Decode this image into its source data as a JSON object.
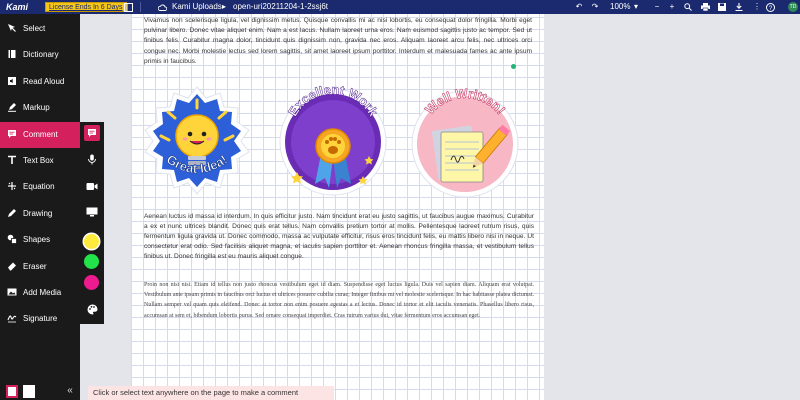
{
  "topbar": {
    "logo": "Kami",
    "license_badge": "License Ends In 6 Days",
    "breadcrumb_folder": "Kami Uploads",
    "breadcrumb_arrow": "▸",
    "document_name": "open-uri20211204-1-2ssj6t",
    "zoom": "100%",
    "user_initials": "TD"
  },
  "sidebar": {
    "tools": [
      {
        "label": "Select",
        "icon": "cursor-icon"
      },
      {
        "label": "Dictionary",
        "icon": "book-icon"
      },
      {
        "label": "Read Aloud",
        "icon": "speaker-icon"
      },
      {
        "label": "Markup",
        "icon": "highlighter-icon"
      },
      {
        "label": "Comment",
        "icon": "comment-icon",
        "active": true
      },
      {
        "label": "Text Box",
        "icon": "text-icon"
      },
      {
        "label": "Equation",
        "icon": "equation-icon"
      },
      {
        "label": "Drawing",
        "icon": "pen-icon"
      },
      {
        "label": "Shapes",
        "icon": "shapes-icon"
      },
      {
        "label": "Eraser",
        "icon": "eraser-icon"
      },
      {
        "label": "Add Media",
        "icon": "media-icon"
      },
      {
        "label": "Signature",
        "icon": "signature-icon"
      }
    ],
    "collapse_glyph": "«"
  },
  "comment_options": {
    "swatches": [
      "#ffeb3b",
      "#22e34a",
      "#ee1a8f"
    ],
    "selected_swatch": "#ffeb3b"
  },
  "document": {
    "paragraph_1": "Vivamus non scelerisque ligula, vel dignissim metus. Quisque convallis mi ac nisi lobortis, eu consequat dolor fringilla. Morbi eget pulvinar libero. Donec vitae aliquet enim. Nam a est lacus. Nullam laoreet urna eros. Nam euismod sagittis justo ac tempor. Sed ut finibus felis. Curabitur magna dolor, tincidunt quis dignissim non, gravida nec eros. Aliquam laoreet arcu felis, nec ultrices orci congue nec. Morbi molestie lectus sed lorem sagittis, sit amet laoreet ipsum porttitor. Interdum et malesuada fames ac ante ipsum primis in faucibus.",
    "paragraph_2": "Aenean luctus id massa id interdum. In quis efficitur justo. Nam tincidunt erat eu justo sagittis, ut faucibus augue maximus. Curabitur a ex et nunc ultrices blandit. Donec quis erat tellus. Nam convallis pretium tortor at mollis. Pellentesque laoreet rutrum risus, quis fermentum ligula gravida ut. Donec commodo, massa ac vulputate efficitur, risus eros tincidunt felis, eu mattis libero nisi in neque. Ut consectetur erat odio. Sed facilisis aliquet magna, et iaculis sapien porttitor et. Aenean rhoncus fringilla massa, et vestibulum tellus finibus ut. Donec fringilla est eu mauris aliquet congue.",
    "paragraph_3": "Proin non nisi nisi. Etiam id tellus non justo rhoncus vestibulum eget id diam. Suspendisse eget luctus ligula. Duis vel sapien diam. Aliquam erat volutpat. Vestibulum ante ipsum primis in faucibus orci luctus et ultrices posuere cubilia curae; Integer finibus mi vel molestie scelerisque. In hac habitasse platea dictumst. Nullam semper vel quam quis eleifend. Donec at tortor non enim posuere egestas a et lectus. Donec id tortor et elit iaculis venenatis. Phasellus libero risus, accumsan at sem et, bibendum lobortis purus. Sed ornare consequat imperdiet. Cras rutrum varius dui, vitae fermentum eros accumsan eget.",
    "stickers": [
      {
        "text": "Great Idea!"
      },
      {
        "text": "Excellent Work"
      },
      {
        "text": "Well Written!"
      }
    ]
  },
  "hint": {
    "text": "Click or select text anywhere on the page to make a comment"
  }
}
